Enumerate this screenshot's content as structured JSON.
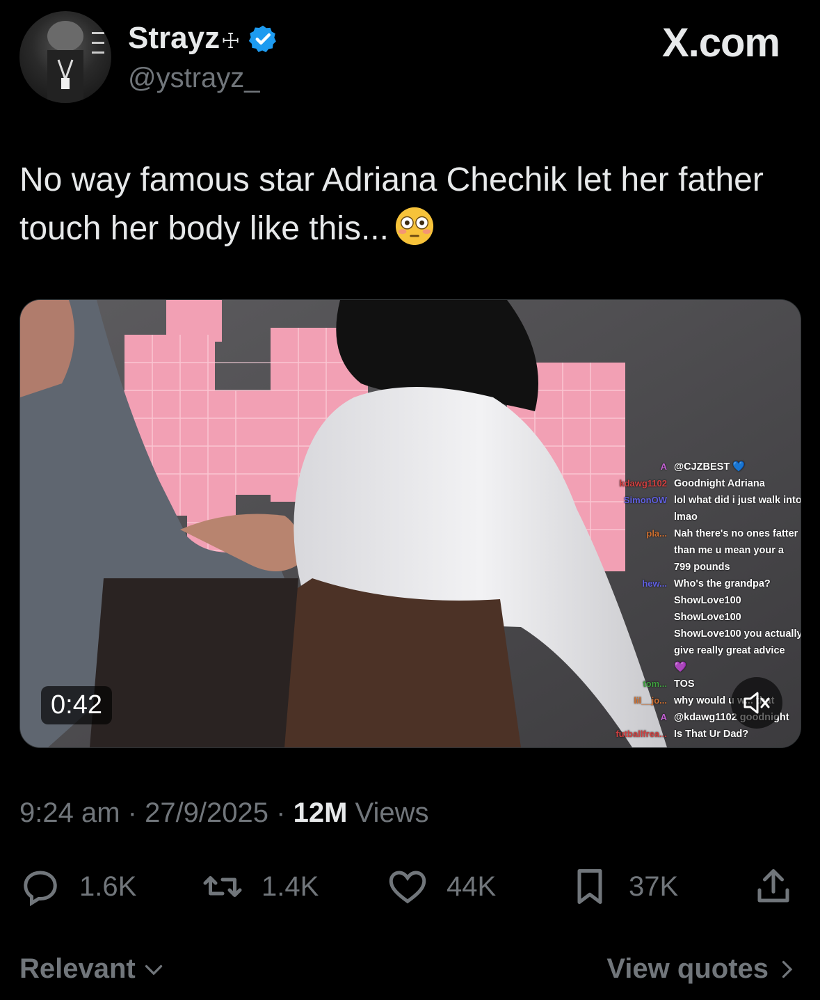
{
  "author": {
    "name": "Strayz",
    "name_glyph": "☩",
    "handle": "@ystrayz_"
  },
  "brand": "X.com",
  "tweet": {
    "text": "No way famous star Adriana Chechik let her father touch her body like this..."
  },
  "video": {
    "duration": "0:42",
    "chat": [
      {
        "user": "A",
        "msg": "@CJZBEST 💙"
      },
      {
        "user": "kdawg1102",
        "msg": "Goodnight Adriana"
      },
      {
        "user": "SimonOW",
        "msg": "lol what did i just walk into"
      },
      {
        "user": "",
        "msg": "lmao"
      },
      {
        "user": "pla...",
        "msg": "Nah there's no ones fatter"
      },
      {
        "user": "",
        "msg": "than me u mean your a"
      },
      {
        "user": "",
        "msg": "799 pounds"
      },
      {
        "user": "hew...",
        "msg": "Who's the grandpa?"
      },
      {
        "user": "",
        "msg": "ShowLove100"
      },
      {
        "user": "",
        "msg": "ShowLove100"
      },
      {
        "user": "",
        "msg": "ShowLove100 you actually"
      },
      {
        "user": "",
        "msg": "give really great advice"
      },
      {
        "user": "",
        "msg": "💜"
      },
      {
        "user": "tom...",
        "msg": "TOS"
      },
      {
        "user": "lil__jo...",
        "msg": "why would u w... that"
      },
      {
        "user": "A",
        "msg": "@kdawg1102 goodnight"
      },
      {
        "user": "futballfrea...",
        "msg": "Is That Ur Dad?"
      }
    ]
  },
  "meta": {
    "time": "9:24 am",
    "date": "27/9/2025",
    "views_count": "12M",
    "views_label": "Views"
  },
  "actions": {
    "replies": "1.6K",
    "reposts": "1.4K",
    "likes": "44K",
    "bookmarks": "37K"
  },
  "footer": {
    "sort_label": "Relevant",
    "view_quotes": "View quotes"
  }
}
